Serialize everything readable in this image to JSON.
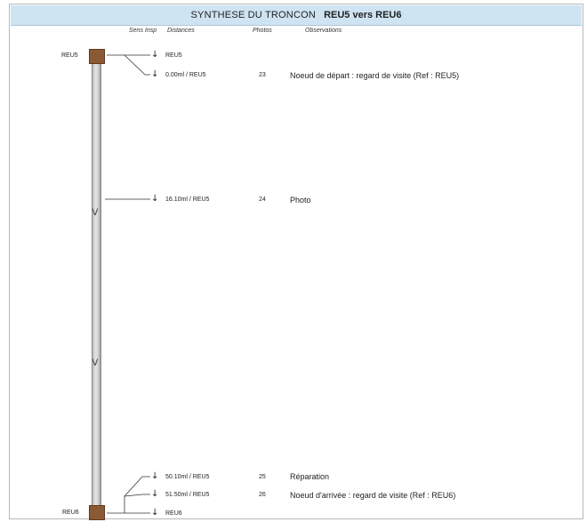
{
  "title": {
    "main": "SYNTHESE DU TRONCON",
    "nodes": "REU5 vers REU6"
  },
  "headers": {
    "sens_insp": "Sens Insp",
    "distances": "Distances",
    "photos": "Photos",
    "observations": "Observations"
  },
  "start_node": "REU5",
  "end_node": "REU6",
  "direction_icon": "v",
  "rows": [
    {
      "label": "REU5",
      "photo": "",
      "observation": ""
    },
    {
      "label": "0.00ml / REU5",
      "photo": "23",
      "observation": "Noeud de départ : regard de visite (Ref : REU5)"
    },
    {
      "label": "16.10ml / REU5",
      "photo": "24",
      "observation": "Photo"
    },
    {
      "label": "50.10ml / REU5",
      "photo": "25",
      "observation": "Réparation"
    },
    {
      "label": "51.50ml / REU5",
      "photo": "26",
      "observation": "Noeud d'arrivée : regard de visite (Ref : REU6)"
    },
    {
      "label": "REU6",
      "photo": "",
      "observation": ""
    }
  ]
}
